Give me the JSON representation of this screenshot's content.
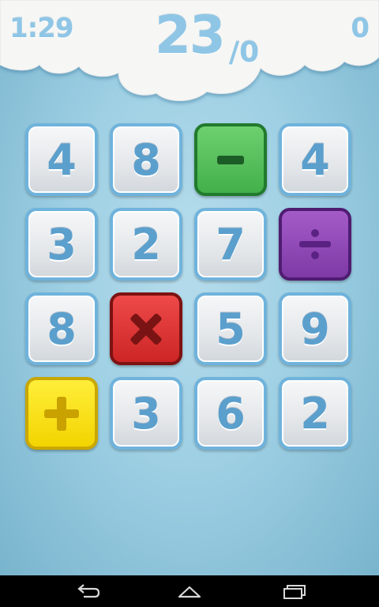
{
  "header": {
    "timer": "1:29",
    "score": "23",
    "score_suffix": "/0",
    "score_right": "0"
  },
  "board": {
    "tiles": [
      "4",
      "8",
      "−",
      "4",
      "3",
      "2",
      "7",
      "÷",
      "8",
      "x",
      "5",
      "9",
      "+",
      "3",
      "6",
      "2"
    ]
  },
  "colors": {
    "number_text": "#5b9fcd",
    "minus_tile": "#42b04a",
    "divide_tile": "#7e3aa6",
    "multiply_tile": "#cd2525",
    "plus_tile": "#f2d400",
    "background": "#9fd0e4"
  },
  "navbar": {
    "icons": [
      "back-icon",
      "home-icon",
      "recent-apps-icon"
    ]
  }
}
